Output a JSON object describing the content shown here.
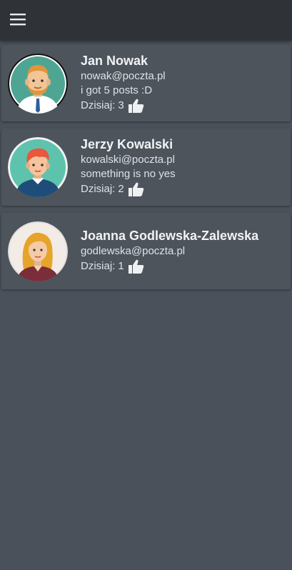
{
  "toolbar": {
    "menu_icon": "hamburger-menu-icon"
  },
  "posts": [
    {
      "name": "Jan Nowak",
      "email": "nowak@poczta.pl",
      "message": "i got 5 posts :D",
      "likes_label": "Dzisiaj:",
      "likes_count": "3"
    },
    {
      "name": "Jerzy Kowalski",
      "email": "kowalski@poczta.pl",
      "message": "something is no yes",
      "likes_label": "Dzisiaj:",
      "likes_count": "2"
    },
    {
      "name": "Joanna Godlewska-Zalewska",
      "email": "godlewska@poczta.pl",
      "likes_label": "Dzisiaj:",
      "likes_count": "1"
    }
  ],
  "colors": {
    "toolbar": "#2f3338",
    "background": "#4a515a",
    "card": "#4d545c",
    "text": "#e8eaed"
  }
}
